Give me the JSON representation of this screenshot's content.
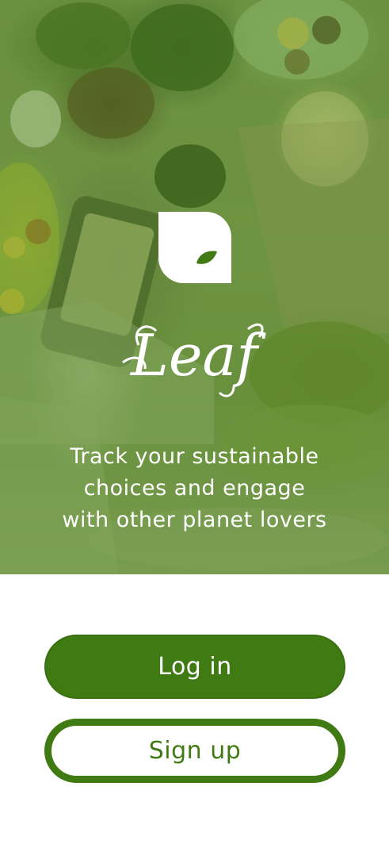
{
  "app": {
    "name": "Leaf",
    "tagline_lines": [
      "Track your sustainable",
      "choices and engage",
      "with other planet lovers"
    ]
  },
  "actions": {
    "login_label": "Log in",
    "signup_label": "Sign up"
  },
  "colors": {
    "brand_green": "#3f7a13",
    "overlay_green": "#4c821e",
    "white": "#ffffff"
  },
  "icons": {
    "logo": "leaf-icon"
  }
}
